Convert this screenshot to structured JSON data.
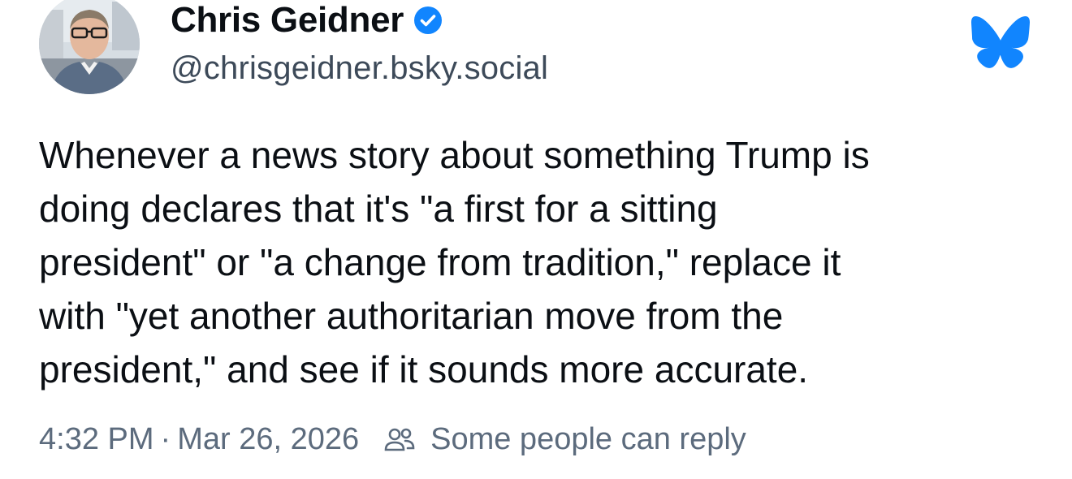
{
  "author": {
    "display_name": "Chris Geidner",
    "handle": "@chrisgeidner.bsky.social",
    "verified": true
  },
  "post": {
    "text": "Whenever a news story about something Trump is\ndoing declares that it's \"a first for a sitting\npresident\" or \"a change from tradition,\" replace it\nwith \"yet another authoritarian move from the\npresident,\" and see if it sounds more accurate."
  },
  "meta": {
    "time": "4:32 PM",
    "separator": "·",
    "date": "Mar 26, 2026",
    "reply_setting": "Some people can reply"
  },
  "icons": {
    "verified": "verified-check-icon",
    "logo": "bluesky-butterfly-icon",
    "people": "people-icon"
  },
  "colors": {
    "brand_blue": "#1185fe",
    "text": "#0b0f14",
    "muted": "#5c6b7d"
  }
}
